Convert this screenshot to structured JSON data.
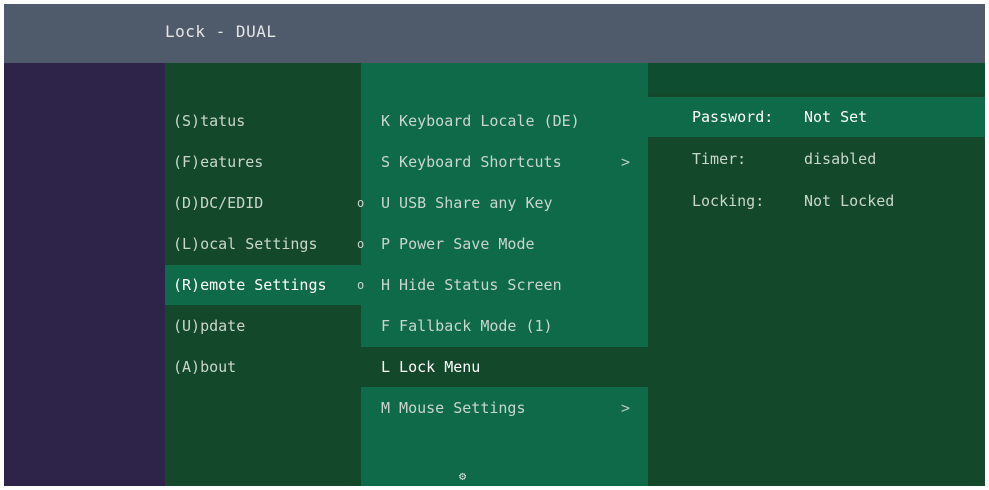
{
  "window": {
    "title": "Lock - DUAL"
  },
  "main_menu": {
    "items": [
      {
        "label": "(S)tatus"
      },
      {
        "label": "(F)eatures"
      },
      {
        "label": "(D)DC/EDID"
      },
      {
        "label": "(L)ocal Settings"
      },
      {
        "label": "(R)emote Settings",
        "selected": true
      },
      {
        "label": "(U)pdate"
      },
      {
        "label": "(A)bout"
      }
    ]
  },
  "submenu": {
    "items": [
      {
        "label": "K Keyboard Locale (DE)",
        "bullet": false,
        "arrow": ""
      },
      {
        "label": "S Keyboard Shortcuts",
        "bullet": false,
        "arrow": ">"
      },
      {
        "label": "U USB Share any Key",
        "bullet": true,
        "arrow": ""
      },
      {
        "label": "P Power Save Mode",
        "bullet": true,
        "arrow": ""
      },
      {
        "label": "H Hide Status Screen",
        "bullet": true,
        "arrow": ""
      },
      {
        "label": "F Fallback Mode (1)",
        "bullet": false,
        "arrow": ""
      },
      {
        "label": "L Lock Menu",
        "bullet": false,
        "arrow": "",
        "selected": true
      },
      {
        "label": "M Mouse Settings",
        "bullet": false,
        "arrow": ">"
      }
    ],
    "bullet_glyph": "o",
    "scroll_indicator": "⚙"
  },
  "detail": {
    "rows": [
      {
        "key": "Password:",
        "value": "Not Set",
        "selected": true
      },
      {
        "key": "Timer:",
        "value": "disabled"
      },
      {
        "key": "Locking:",
        "value": "Not Locked"
      }
    ]
  },
  "colors": {
    "background": "#2e2449",
    "titlebar": "#4f5a6a",
    "menu_dark": "#14482a",
    "menu_light": "#0f6a4a"
  }
}
